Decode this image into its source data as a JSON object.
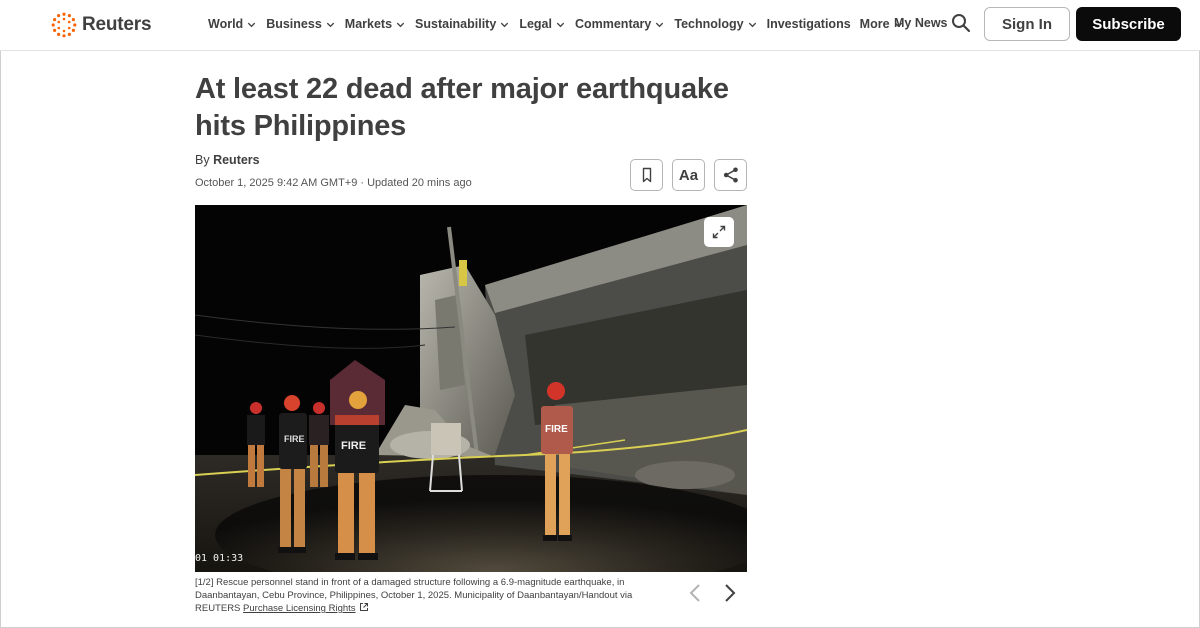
{
  "brand": {
    "name": "Reuters",
    "accent": "#fa6400"
  },
  "nav": {
    "items": [
      {
        "label": "World",
        "has_menu": true
      },
      {
        "label": "Business",
        "has_menu": true
      },
      {
        "label": "Markets",
        "has_menu": true
      },
      {
        "label": "Sustainability",
        "has_menu": true
      },
      {
        "label": "Legal",
        "has_menu": true
      },
      {
        "label": "Commentary",
        "has_menu": true
      },
      {
        "label": "Technology",
        "has_menu": true
      },
      {
        "label": "Investigations",
        "has_menu": false
      },
      {
        "label": "More",
        "has_menu": true
      }
    ],
    "my_news": "My News",
    "search_icon": "search-icon",
    "sign_in": "Sign In",
    "subscribe": "Subscribe"
  },
  "article": {
    "headline": "At least 22 dead after major earthquake hits Philippines",
    "byline_prefix": "By",
    "author": "Reuters",
    "dateline": "October 1, 2025 9:42 AM GMT+9 · Updated 20 mins ago",
    "tools": {
      "bookmark_icon": "bookmark-icon",
      "font_label": "Aa",
      "share_icon": "share-icon"
    }
  },
  "media": {
    "timestamp": "01 01:33",
    "expand_icon": "expand-icon",
    "caption_index": "[1/2]",
    "caption": "Rescue personnel stand in front of a damaged structure following a 6.9-magnitude earthquake, in Daanbantayan, Cebu Province, Philippines, October 1, 2025. Municipality of Daanbantayan/Handout via REUTERS",
    "licensing_link": "Purchase Licensing Rights",
    "prev_icon": "chevron-left-icon",
    "next_icon": "chevron-right-icon",
    "vest_label": "FIRE"
  }
}
